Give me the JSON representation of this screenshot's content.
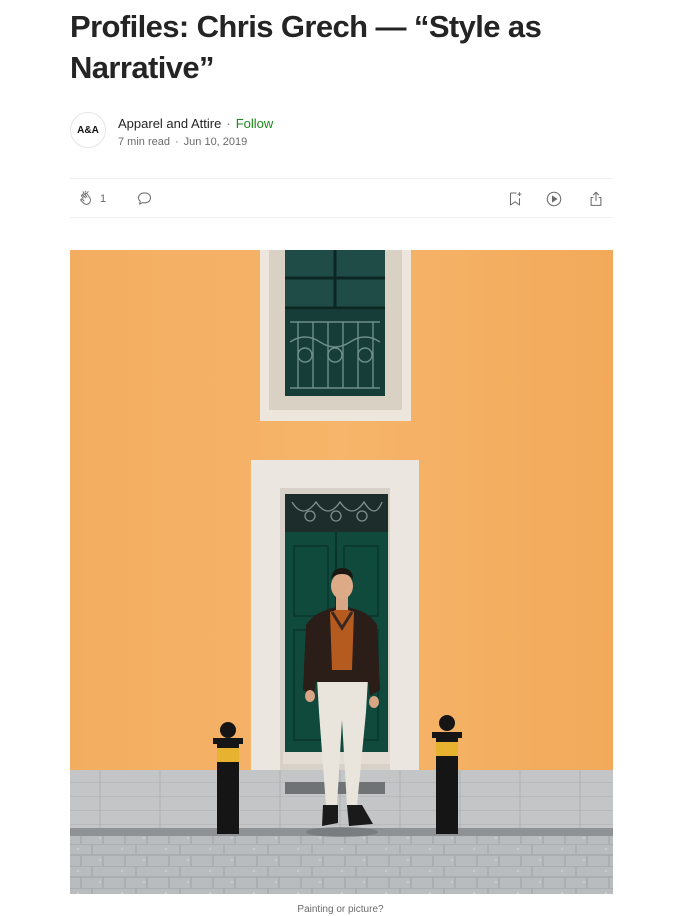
{
  "article": {
    "title": "Profiles: Chris Grech — “Style as Narrative”",
    "publication": {
      "avatar_text": "A&A",
      "name": "Apparel and Attire",
      "separator": "·",
      "follow_label": "Follow"
    },
    "read_time": "7 min read",
    "meta_separator": "·",
    "date": "Jun 10, 2019",
    "clap_count": "1",
    "caption": "Painting or picture?"
  },
  "icons": {
    "clap": "clap-icon",
    "responses": "comment-icon",
    "bookmark": "bookmark-add-icon",
    "listen": "play-icon",
    "share": "share-icon"
  },
  "colors": {
    "follow": "#1a8917",
    "text": "#242424",
    "muted": "#6b6b6b",
    "wall": "#f4ac5c",
    "door": "#0f4a3d"
  }
}
